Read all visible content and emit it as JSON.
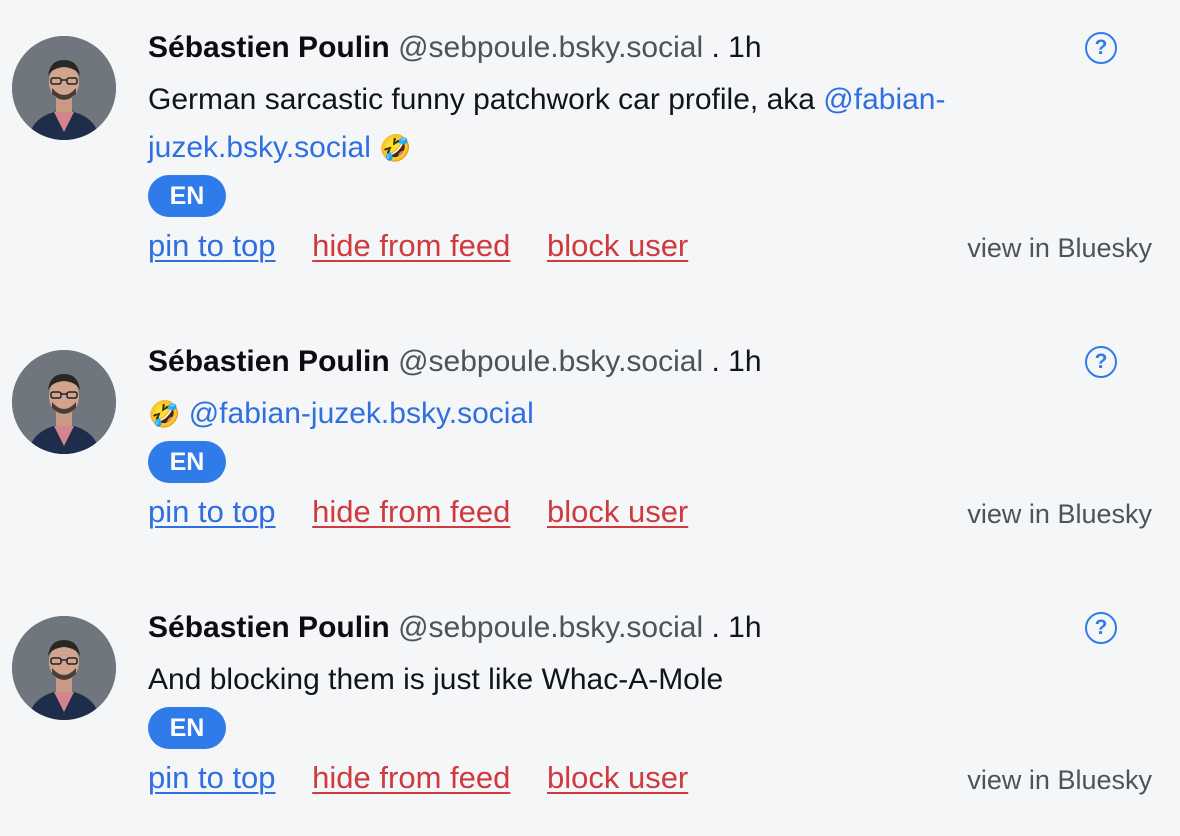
{
  "posts": [
    {
      "author_name": "Sébastien Poulin",
      "handle": "@sebpoule.bsky.social",
      "separator": ".",
      "time": "1h",
      "help_label": "?",
      "text_before": "German sarcastic funny patchwork car profile, aka ",
      "mention": "@fabian-juzek.bsky.social",
      "emoji": "🤣",
      "language": "EN",
      "actions": {
        "pin": "pin to top",
        "hide": "hide from feed",
        "block": "block user",
        "view": "view in Bluesky"
      }
    },
    {
      "author_name": "Sébastien Poulin",
      "handle": "@sebpoule.bsky.social",
      "separator": ".",
      "time": "1h",
      "help_label": "?",
      "emoji": "🤣",
      "mention": "@fabian-juzek.bsky.social",
      "language": "EN",
      "actions": {
        "pin": "pin to top",
        "hide": "hide from feed",
        "block": "block user",
        "view": "view in Bluesky"
      }
    },
    {
      "author_name": "Sébastien Poulin",
      "handle": "@sebpoule.bsky.social",
      "separator": ".",
      "time": "1h",
      "help_label": "?",
      "text": "And blocking them is just like Whac-A-Mole",
      "language": "EN",
      "actions": {
        "pin": "pin to top",
        "hide": "hide from feed",
        "block": "block user",
        "view": "view in Bluesky"
      }
    }
  ],
  "colors": {
    "accent": "#2f7bea",
    "link": "#2f6fe0",
    "danger": "#cf3a3f",
    "muted": "#4b535c",
    "background": "#f5f6f8"
  }
}
